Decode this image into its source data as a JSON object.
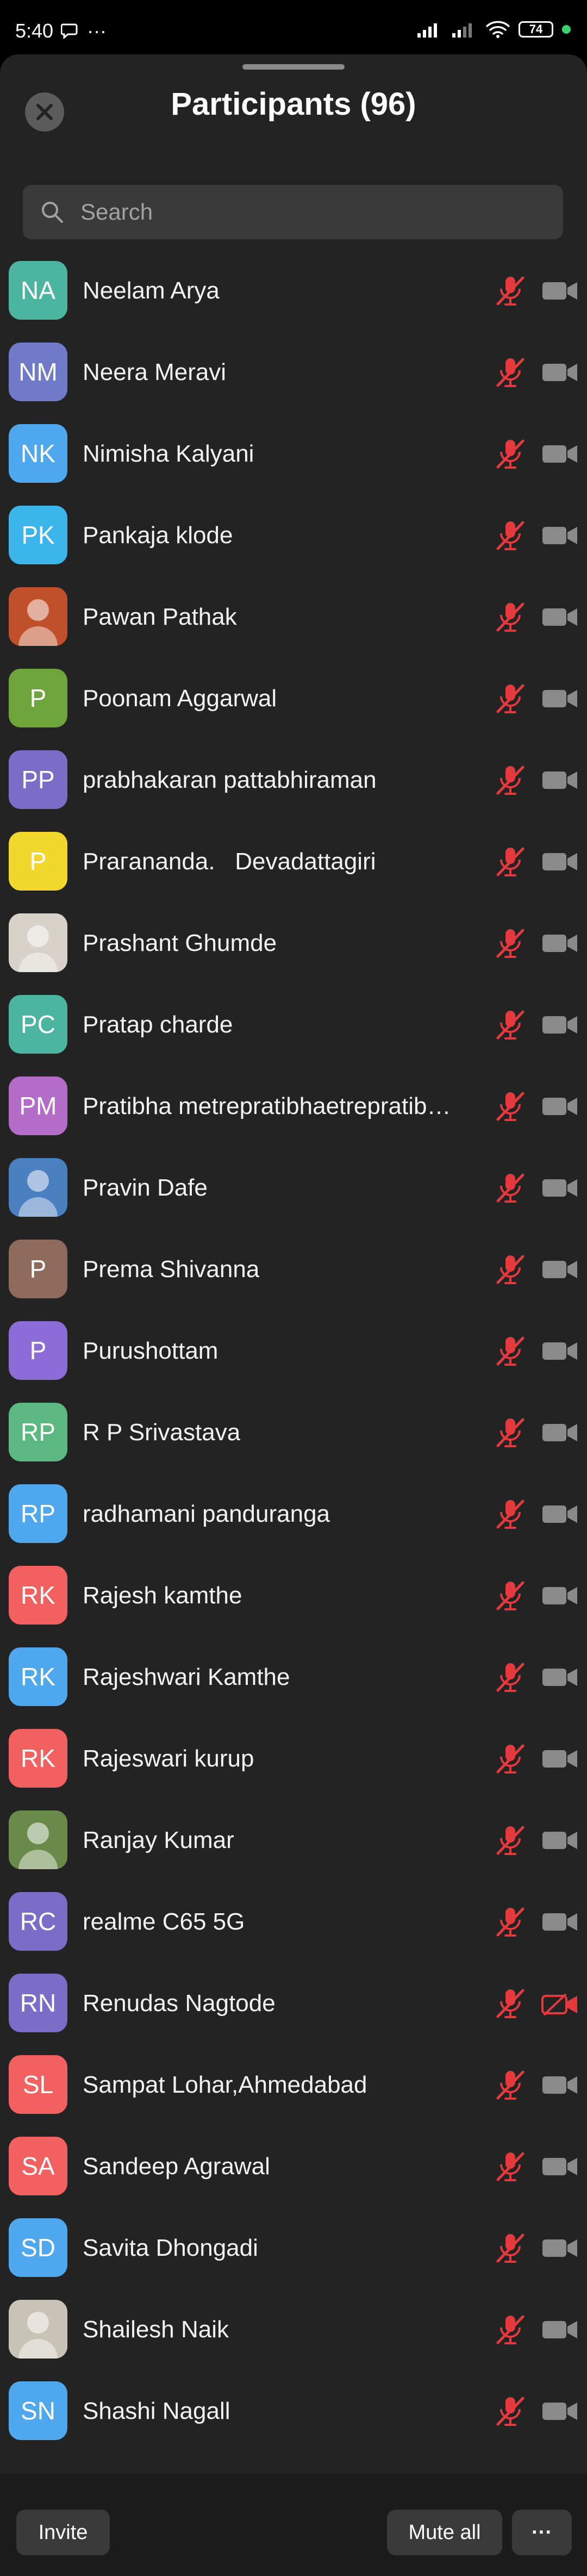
{
  "status_bar": {
    "time": "5:40",
    "dots": "···",
    "battery": "74"
  },
  "header": {
    "title": "Participants (96)",
    "close_icon": "close-icon"
  },
  "search": {
    "placeholder": "Search"
  },
  "participants": [
    {
      "initials": "",
      "name": "",
      "color": "#5aaee8"
    },
    {
      "initials": "NA",
      "name": "Neelam Arya",
      "color": "#4cb5a0"
    },
    {
      "initials": "NM",
      "name": "Neera Meravi",
      "color": "#6f7ac9"
    },
    {
      "initials": "NK",
      "name": "Nimisha Kalyani",
      "color": "#4fa8ee"
    },
    {
      "initials": "PK",
      "name": "Pankaja klode",
      "color": "#3bb4ea"
    },
    {
      "initials": "",
      "name": "Pawan Pathak",
      "color": "#c0502a",
      "photo": "deity-photo"
    },
    {
      "initials": "P",
      "name": "Poonam Aggarwal",
      "color": "#6fa43a"
    },
    {
      "initials": "PP",
      "name": "prabhakaran pattabhiraman",
      "color": "#7b6cc8"
    },
    {
      "initials": "P",
      "name": "Prагananda.   Devadattagiri",
      "color": "#f2d72c"
    },
    {
      "initials": "",
      "name": "Prashant Ghumde",
      "color": "#d8d2cb",
      "photo": "masked-person-photo"
    },
    {
      "initials": "PC",
      "name": "Pratap charde",
      "color": "#4cb5a0"
    },
    {
      "initials": "PM",
      "name": "Pratibha metrepratibhaetrepratibhaetre",
      "color": "#b36cc8"
    },
    {
      "initials": "",
      "name": "Pravin Dafe",
      "color": "#4a7fc0",
      "photo": "bird-photo"
    },
    {
      "initials": "P",
      "name": "Prema Shivanna",
      "color": "#8d6a5c"
    },
    {
      "initials": "P",
      "name": "Purushottam",
      "color": "#8c6cd6"
    },
    {
      "initials": "RP",
      "name": "R P Srivastava",
      "color": "#5bb880"
    },
    {
      "initials": "RP",
      "name": "radhamani panduranga",
      "color": "#4fa8ee"
    },
    {
      "initials": "RK",
      "name": "Rajesh kamthe",
      "color": "#f26060"
    },
    {
      "initials": "RK",
      "name": "Rajeshwari Kamthe",
      "color": "#4fa8ee"
    },
    {
      "initials": "RK",
      "name": "Rajeswari kurup",
      "color": "#f26060"
    },
    {
      "initials": "",
      "name": "Ranjay Kumar",
      "color": "#6a8a4a",
      "photo": "outdoor-person-photo"
    },
    {
      "initials": "RC",
      "name": "realme C65 5G",
      "color": "#7b6cc8"
    },
    {
      "initials": "RN",
      "name": "Renudas Nagtode",
      "color": "#7b6cc8",
      "video_off": true
    },
    {
      "initials": "SL",
      "name": "Sampat Lohar,Ahmedabad",
      "color": "#f26060"
    },
    {
      "initials": "SA",
      "name": "Sandeep Agrawal",
      "color": "#f26060"
    },
    {
      "initials": "SD",
      "name": "Savita Dhongadi",
      "color": "#4fa8ee"
    },
    {
      "initials": "",
      "name": "Shailesh Naik",
      "color": "#c9c2b6",
      "photo": "person-photo"
    },
    {
      "initials": "SN",
      "name": "Shashi Nagall",
      "color": "#4fa8ee"
    }
  ],
  "footer": {
    "invite": "Invite",
    "mute_all": "Mute all",
    "more": "···"
  },
  "colors": {
    "sheet_bg": "#232323",
    "mic_muted": "#e5393e",
    "cam": "#8a8a8a",
    "footer_bg": "#1b1b1b"
  }
}
